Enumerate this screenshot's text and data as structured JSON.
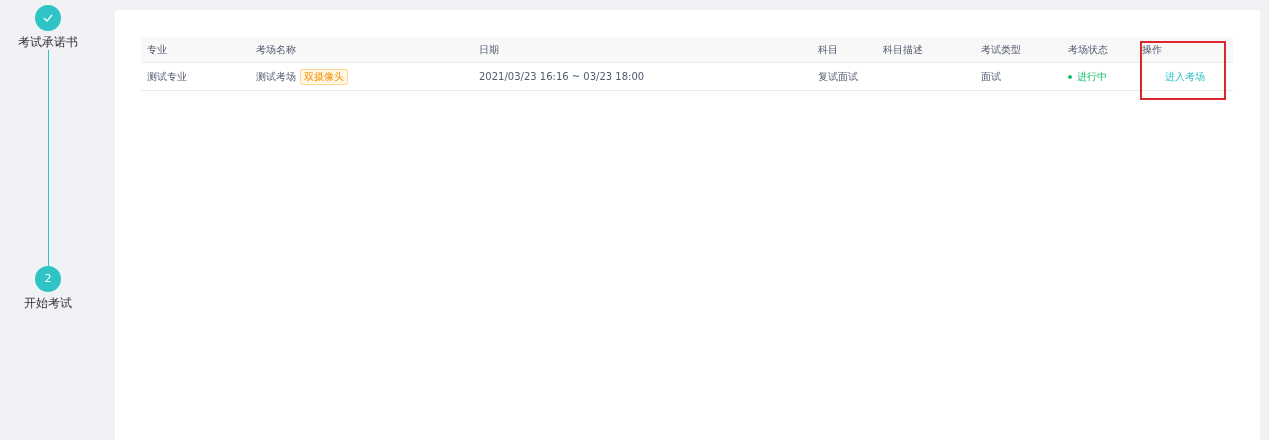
{
  "steps": [
    {
      "label": "考试承诺书",
      "completed": true
    },
    {
      "label": "开始考试",
      "completed": false,
      "number": "2"
    }
  ],
  "table": {
    "columns": [
      {
        "label": "专业",
        "highlighted": false
      },
      {
        "label": "考场名称",
        "highlighted": false
      },
      {
        "label": "日期",
        "highlighted": false
      },
      {
        "label": "科目",
        "highlighted": false
      },
      {
        "label": "科目描述",
        "highlighted": false
      },
      {
        "label": "考试类型",
        "highlighted": false
      },
      {
        "label": "考场状态",
        "highlighted": false
      },
      {
        "label": "操作",
        "highlighted": true
      }
    ],
    "rows": [
      {
        "major": "测试专业",
        "room": "测试考场",
        "tag": "双摄像头",
        "date": "2021/03/23 16:16 ~ 03/23 18:00",
        "subject": "复试面试",
        "description": "",
        "exam_type": "面试",
        "status": {
          "text": "进行中",
          "color": "#19be6b"
        },
        "action": "进入考场"
      }
    ]
  }
}
